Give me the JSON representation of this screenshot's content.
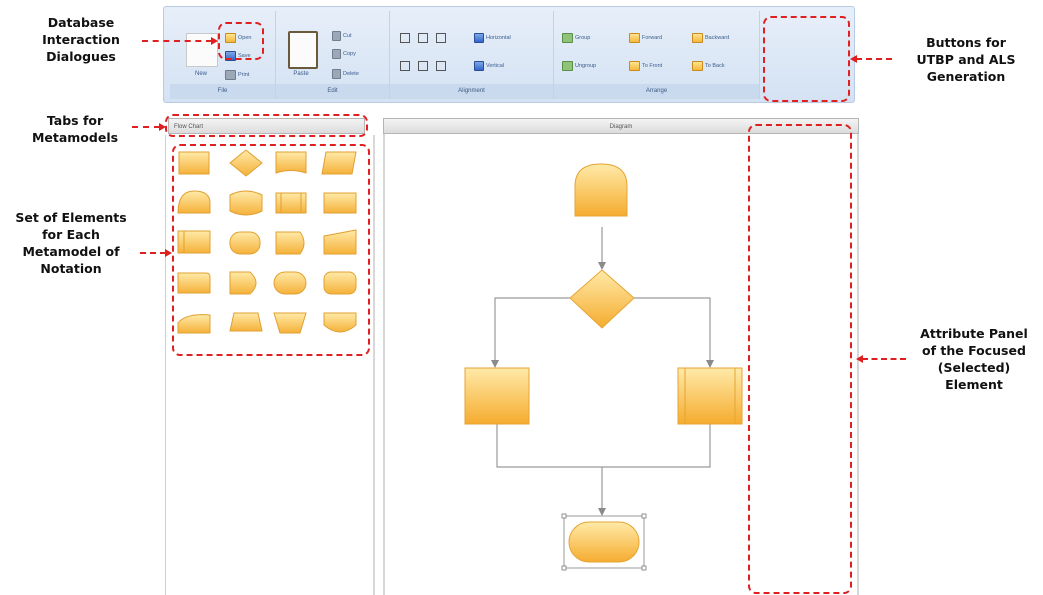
{
  "annotations": {
    "database": [
      "Database",
      "Interaction",
      "Dialogues"
    ],
    "tabs": [
      "Tabs for",
      "Metamodels"
    ],
    "elements": [
      "Set of Elements",
      "for Each",
      "Metamodel of",
      "Notation"
    ],
    "buttons": [
      "Buttons for",
      "UTBP and ALS",
      "Generation"
    ],
    "attributes": [
      "Attribute Panel",
      "of the Focused",
      "(Selected)",
      "Element"
    ]
  },
  "ribbon": {
    "file": {
      "title": "File",
      "new": "New",
      "open": "Open",
      "save": "Save",
      "print": "Print"
    },
    "edit": {
      "title": "Edit",
      "paste": "Paste",
      "cut": "Cut",
      "copy": "Copy",
      "delete": "Delete"
    },
    "alignment": {
      "title": "Alignment",
      "horizontal": "Horizontal",
      "vertical": "Vertical"
    },
    "arrange": {
      "title": "Arrange",
      "group": "Group",
      "ungroup": "Ungroup",
      "forward": "Forward",
      "backward": "Backward",
      "to_front": "To Front",
      "to_back": "To Back"
    }
  },
  "palette": {
    "tab_label": "Flow Chart"
  },
  "diagram": {
    "tab_label": "Diagram"
  },
  "colors": {
    "accent": "#f6b53e",
    "annotation": "#e02020",
    "ribbon": "#d4e2f3"
  }
}
